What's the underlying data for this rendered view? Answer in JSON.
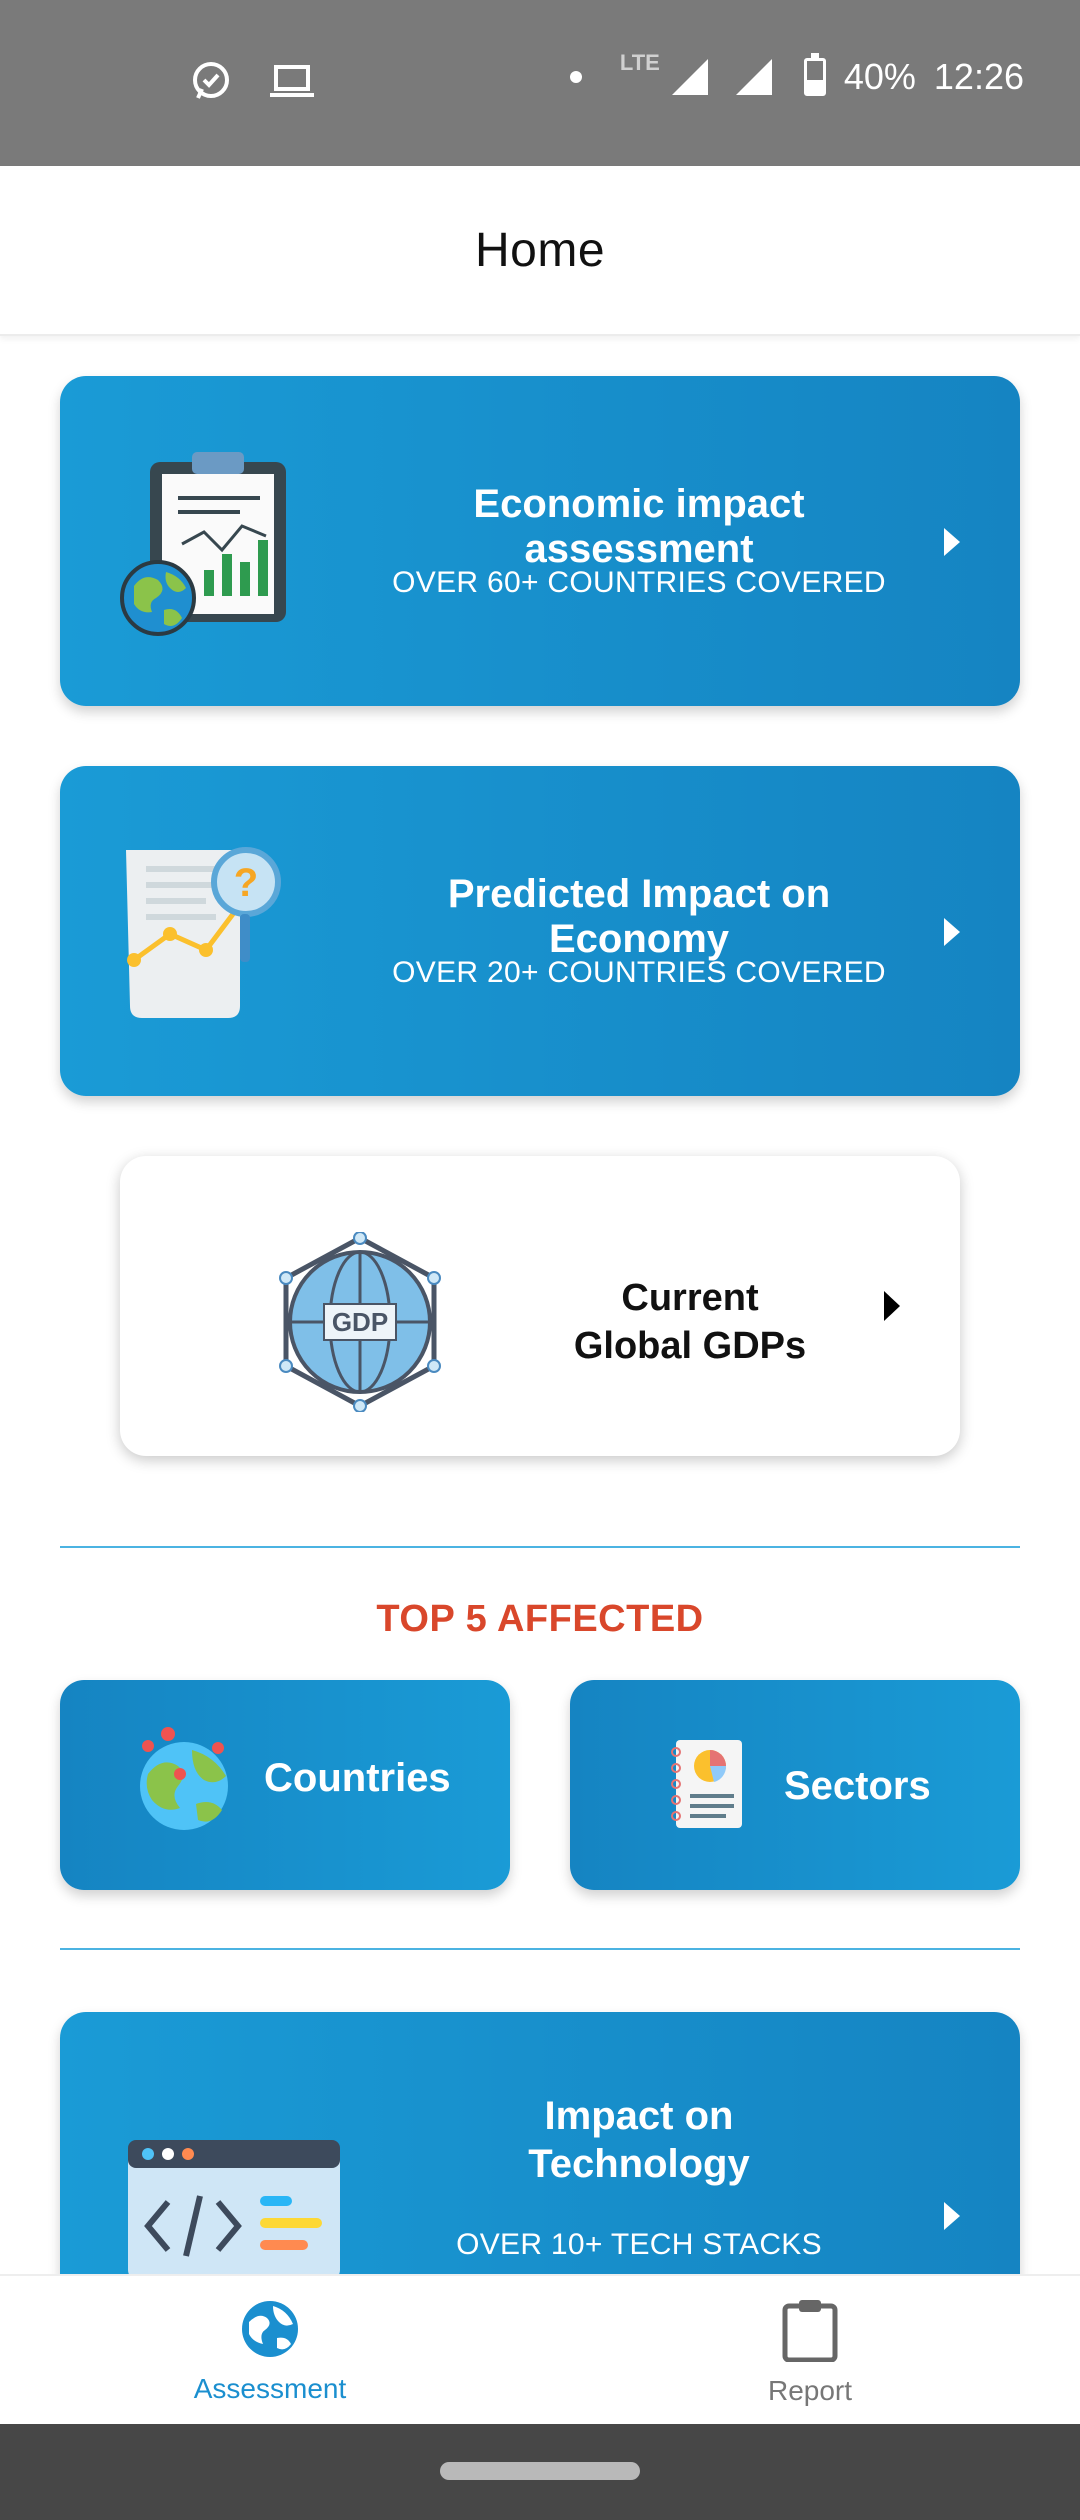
{
  "status_bar": {
    "battery": "40%",
    "time": "12:26",
    "network": "LTE",
    "left_icons": [
      "whatsapp-icon",
      "laptop-icon"
    ],
    "right_icons": [
      "dot-icon",
      "signal-icon",
      "signal-icon",
      "battery-icon"
    ]
  },
  "header": {
    "title": "Home"
  },
  "cards": [
    {
      "title": "Economic impact assessment",
      "subtitle": "OVER 60+ COUNTRIES COVERED",
      "icon": "clipboard-chart-globe-icon"
    },
    {
      "title": "Predicted Impact on Economy",
      "subtitle": "OVER 20+ COUNTRIES COVERED",
      "icon": "report-magnifier-icon"
    }
  ],
  "gdp_card": {
    "line1": "Current",
    "line2": "Global GDPs",
    "icon_text": "GDP",
    "icon": "gdp-globe-icon"
  },
  "top_affected": {
    "title": "TOP 5 AFFECTED",
    "countries_label": "Countries",
    "sectors_label": "Sectors"
  },
  "tech_card": {
    "line1": "Impact on",
    "line2": "Technology",
    "subtitle": "OVER 10+ TECH STACKS",
    "icon": "code-window-icon"
  },
  "bottom_nav": [
    {
      "label": "Assessment",
      "icon": "globe-icon",
      "active": true
    },
    {
      "label": "Report",
      "icon": "clipboard-icon",
      "active": false
    }
  ],
  "colors": {
    "accent": "#1a9bd6",
    "section_title": "#d9472b",
    "active_nav": "#1b8fcf"
  }
}
